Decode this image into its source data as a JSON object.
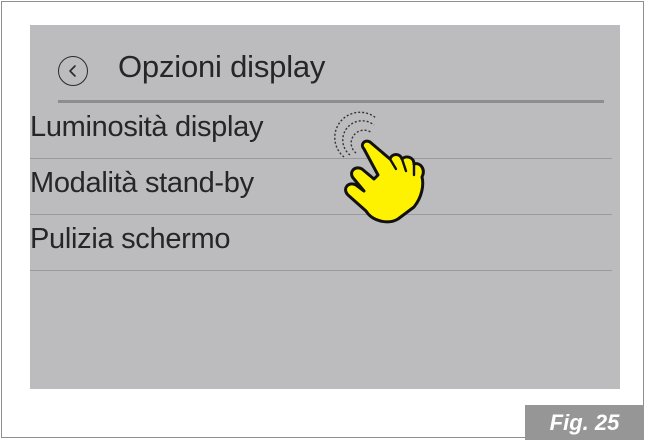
{
  "header": {
    "title": "Opzioni display",
    "back_icon": "chevron-left-icon"
  },
  "menu": {
    "items": [
      {
        "label": "Luminosità display"
      },
      {
        "label": "Modalità stand-by"
      },
      {
        "label": "Pulizia schermo"
      }
    ]
  },
  "overlay": {
    "gesture_icon": "tap-hand-icon",
    "hand_color": "#fff200"
  },
  "figure": {
    "label": "Fig. 25"
  },
  "colors": {
    "screen_background": "#bcbcbe",
    "text": "#262626",
    "figure_badge": "#969696"
  }
}
